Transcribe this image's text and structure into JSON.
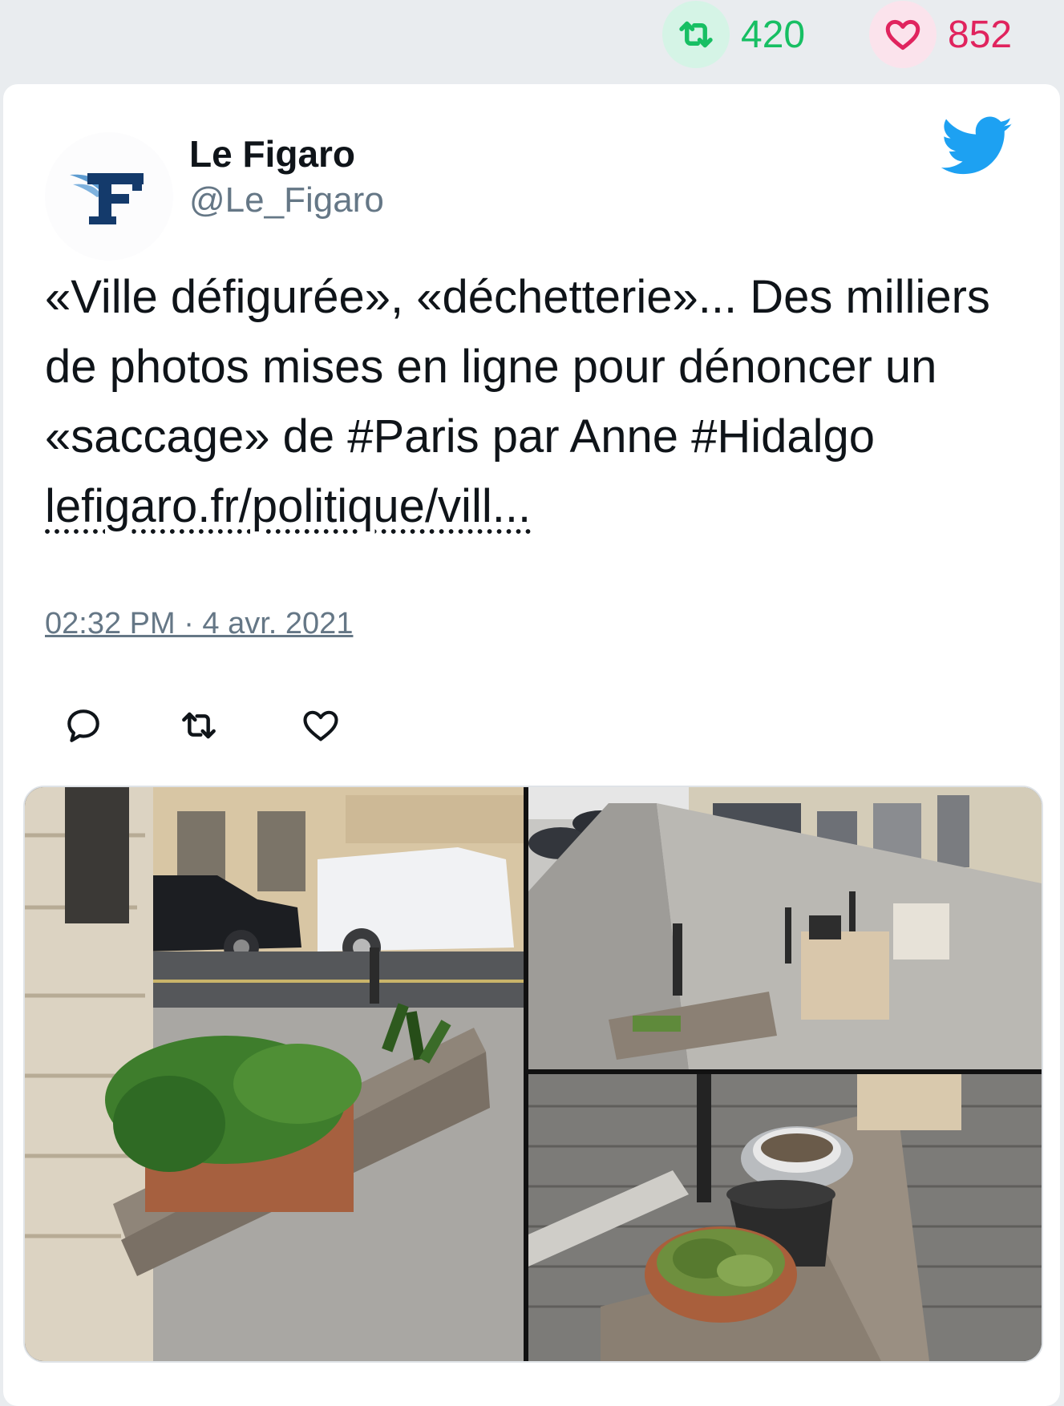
{
  "stats": {
    "retweets": "420",
    "likes": "852",
    "retweet_icon": "retweet-icon",
    "like_icon": "heart-icon",
    "retweet_color": "#17bf63",
    "like_color": "#e0245e"
  },
  "tweet": {
    "author_name": "Le Figaro",
    "author_handle": "@Le_Figaro",
    "text_main": "«Ville défigurée», «déchetterie»... Des milliers de photos mises en ligne pour dénoncer un «saccage» de #Paris par Anne #Hidalgo ",
    "link_text": "lefigaro.fr/politique/vill...",
    "timestamp": "02:32 PM · 4 avr. 2021",
    "brand_icon": "twitter-bird-icon",
    "brand_color": "#1da1f2"
  },
  "actions": [
    {
      "icon": "reply-icon"
    },
    {
      "icon": "retweet-icon"
    },
    {
      "icon": "like-icon"
    }
  ],
  "media": {
    "photos": [
      {
        "subject": "broken wooden planter with plants and bottles on a sidewalk"
      },
      {
        "subject": "Paris street with bollards and wooden planters"
      },
      {
        "subject": "wooden planter with pots on cobblestones"
      }
    ]
  }
}
